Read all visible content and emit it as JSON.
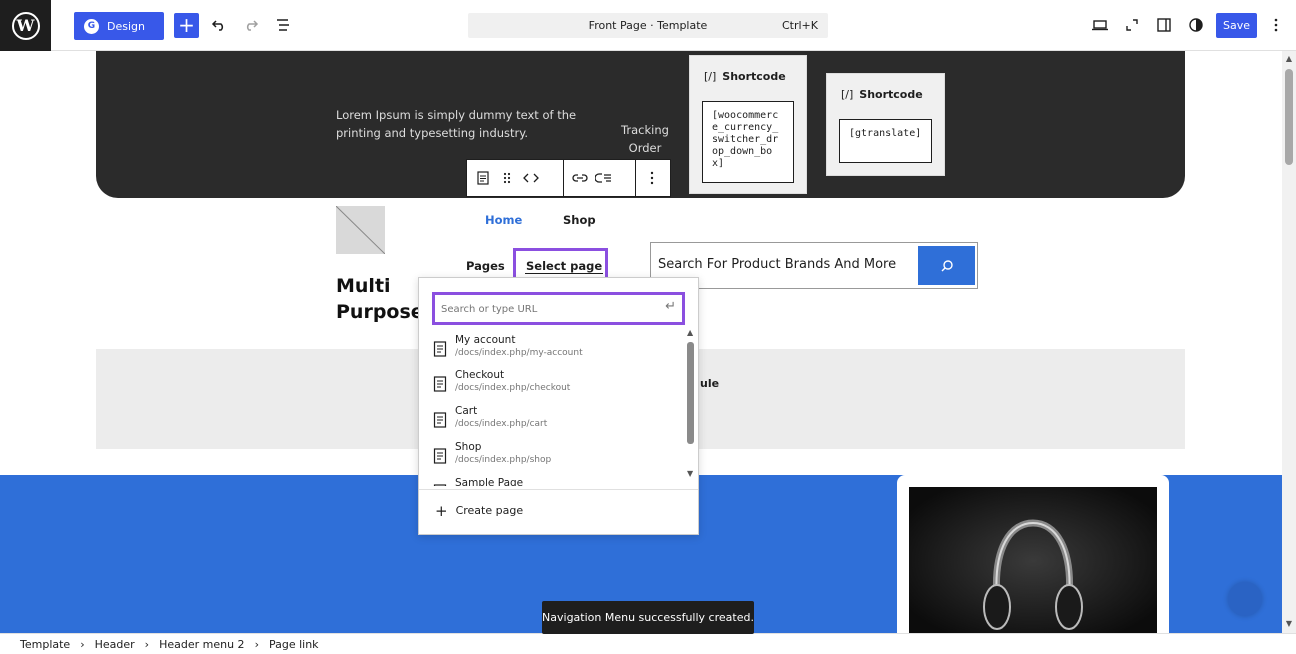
{
  "topbar": {
    "design_label": "Design",
    "command_bar": "Front Page · Template",
    "command_shortcut": "Ctrl+K",
    "save_label": "Save"
  },
  "header": {
    "lorem": "Lorem Ipsum is simply dummy text of the printing and typesetting industry.",
    "tracking": "Tracking Order",
    "shortcode_1": {
      "title": "Shortcode",
      "code": "[woocommerce_currency_switcher_drop_down_box]"
    },
    "shortcode_2": {
      "title": "Shortcode",
      "code": "[gtranslate]"
    }
  },
  "nav": {
    "home": "Home",
    "shop": "Shop",
    "pages": "Pages",
    "select_page": "Select page"
  },
  "search": {
    "text": "Search For Product Brands And More"
  },
  "site_title": "Multi Purpose",
  "band_text": "ule",
  "link_popover": {
    "placeholder": "Search or type URL",
    "items": [
      {
        "name": "My account",
        "url": "/docs/index.php/my-account"
      },
      {
        "name": "Checkout",
        "url": "/docs/index.php/checkout"
      },
      {
        "name": "Cart",
        "url": "/docs/index.php/cart"
      },
      {
        "name": "Shop",
        "url": "/docs/index.php/shop"
      },
      {
        "name": "Sample Page",
        "url": ""
      }
    ],
    "create_label": "Create page"
  },
  "snackbar": "Navigation Menu successfully created.",
  "breadcrumb": [
    "Template",
    "Header",
    "Header menu 2",
    "Page link"
  ],
  "colors": {
    "accent": "#3858e9",
    "selection": "#8b4fe0",
    "site_blue": "#2f6fd8",
    "dark_header": "#2b2b2b"
  }
}
